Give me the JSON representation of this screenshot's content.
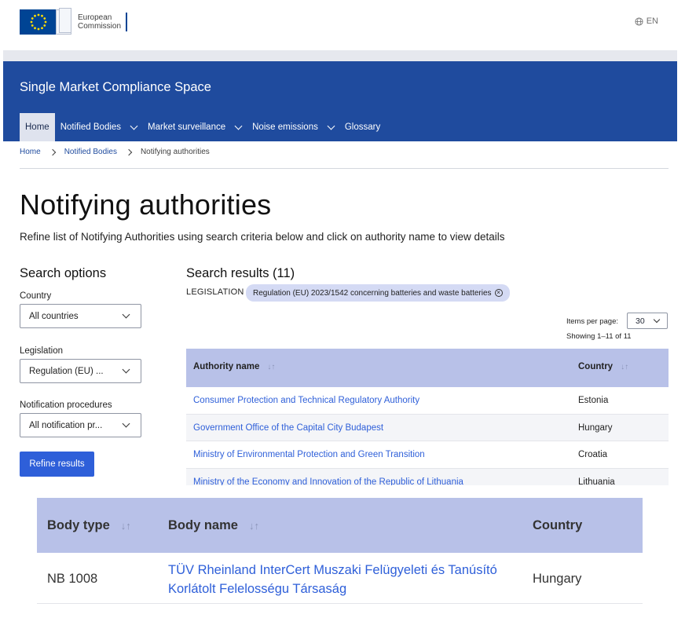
{
  "header": {
    "org_line1": "European",
    "org_line2": "Commission",
    "language": "EN"
  },
  "site": {
    "title": "Single Market Compliance Space",
    "nav": [
      {
        "label": "Home",
        "active": true,
        "dropdown": false
      },
      {
        "label": "Notified Bodies",
        "active": false,
        "dropdown": true
      },
      {
        "label": "Market surveillance",
        "active": false,
        "dropdown": true
      },
      {
        "label": "Noise emissions",
        "active": false,
        "dropdown": true
      },
      {
        "label": "Glossary",
        "active": false,
        "dropdown": false
      }
    ]
  },
  "breadcrumb": [
    "Home",
    "Notified Bodies",
    "Notifying authorities"
  ],
  "page": {
    "title": "Notifying authorities",
    "intro": "Refine list of Notifying Authorities using search criteria below and click on authority name to view details"
  },
  "search_options": {
    "title": "Search options",
    "country_label": "Country",
    "country_value": "All countries",
    "legislation_label": "Legislation",
    "legislation_value": "Regulation (EU) ...",
    "procedures_label": "Notification procedures",
    "procedures_value": "All notification pr...",
    "refine_button": "Refine results"
  },
  "results": {
    "title": "Search results (11)",
    "legislation_label": "LEGISLATION",
    "legislation_chip": "Regulation (EU) 2023/1542 concerning batteries and waste batteries",
    "items_per_page_label": "Items per page:",
    "items_per_page_value": "30",
    "showing": "Showing 1–11 of 11",
    "columns": [
      "Authority name",
      "Country"
    ],
    "rows": [
      {
        "name": "Consumer Protection and Technical Regulatory Authority",
        "country": "Estonia"
      },
      {
        "name": "Government Office of the Capital City Budapest",
        "country": "Hungary"
      },
      {
        "name": "Ministry of Environmental Protection and Green Transition",
        "country": "Croatia"
      },
      {
        "name": "Ministry of the Economy and Innovation of the Republic of Lithuania",
        "country": "Lithuania"
      }
    ]
  },
  "bodies_table": {
    "columns": [
      "Body type",
      "Body name",
      "Country"
    ],
    "rows": [
      {
        "type": "NB 1008",
        "name": "TÜV Rheinland InterCert Muszaki Felügyeleti és Tanúsító Korlátolt Felelosségu Társaság",
        "country": "Hungary"
      }
    ]
  },
  "colors": {
    "brand_blue": "#1f4b9e",
    "link_blue": "#2e5fd9",
    "table_header": "#b8c1e8"
  }
}
